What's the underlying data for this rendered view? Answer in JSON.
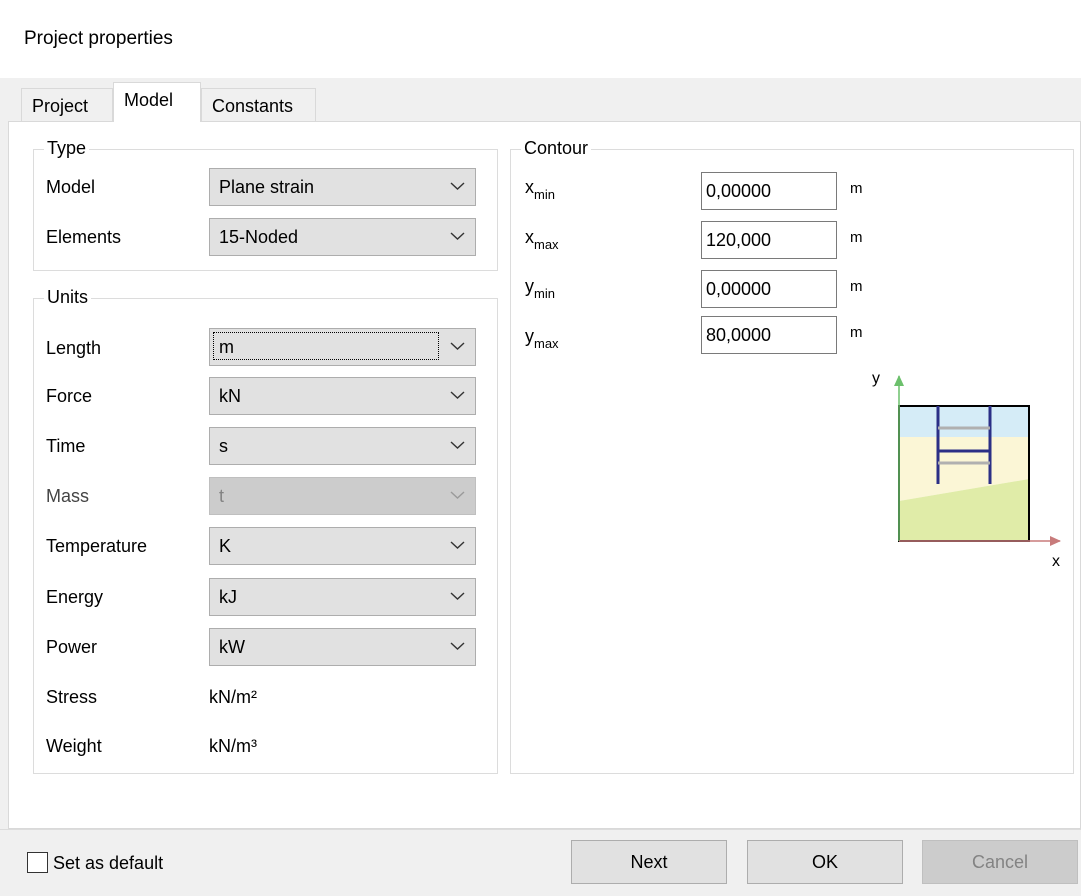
{
  "window": {
    "title": "Project properties"
  },
  "tabs": [
    {
      "label": "Project"
    },
    {
      "label": "Model"
    },
    {
      "label": "Constants"
    }
  ],
  "type_group": {
    "title": "Type",
    "model_label": "Model",
    "model_value": "Plane strain",
    "elements_label": "Elements",
    "elements_value": "15-Noded"
  },
  "units_group": {
    "title": "Units",
    "length_label": "Length",
    "length_value": "m",
    "force_label": "Force",
    "force_value": "kN",
    "time_label": "Time",
    "time_value": "s",
    "mass_label": "Mass",
    "mass_value": "t",
    "temperature_label": "Temperature",
    "temperature_value": "K",
    "energy_label": "Energy",
    "energy_value": "kJ",
    "power_label": "Power",
    "power_value": "kW",
    "stress_label": "Stress",
    "stress_value": "kN/m²",
    "weight_label": "Weight",
    "weight_value": "kN/m³"
  },
  "contour_group": {
    "title": "Contour",
    "xmin": {
      "base": "x",
      "sub": "min",
      "value": "0,00000",
      "unit": "m"
    },
    "xmax": {
      "base": "x",
      "sub": "max",
      "value": "120,000",
      "unit": "m"
    },
    "ymin": {
      "base": "y",
      "sub": "min",
      "value": "0,00000",
      "unit": "m"
    },
    "ymax": {
      "base": "y",
      "sub": "max",
      "value": "80,0000",
      "unit": "m"
    },
    "diagram": {
      "y_axis_label": "y",
      "x_axis_label": "x"
    }
  },
  "footer": {
    "default_checkbox_label": "Set as default",
    "next_label": "Next",
    "ok_label": "OK",
    "cancel_label": "Cancel"
  },
  "colors": {
    "sky": "#d5ecf7",
    "sand": "#fbf6d6",
    "grass": "#e0eca8",
    "pile": "#2b2f86",
    "y_axis": "#6cc06c",
    "x_axis": "#c87b7b"
  }
}
